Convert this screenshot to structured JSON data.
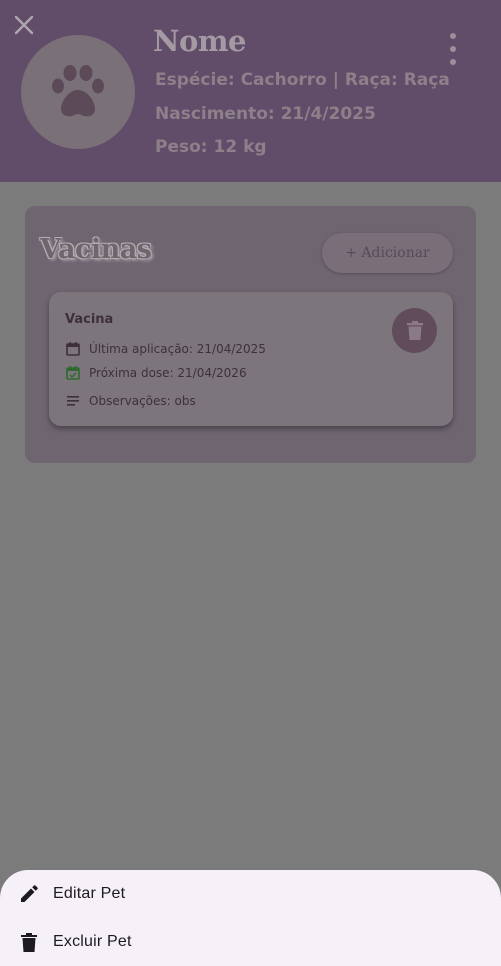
{
  "pet": {
    "name": "Nome",
    "species_line": "Espécie: Cachorro | Raça: Raça",
    "birth_line": "Nascimento: 21/4/2025",
    "weight_line": "Peso: 12 kg"
  },
  "vaccines": {
    "title": "Vacinas",
    "add_label": "+ Adicionar",
    "items": [
      {
        "name": "Vacina",
        "last_application": "Última aplicação: 21/04/2025",
        "next_dose": "Próxima dose: 21/04/2026",
        "notes": "Observações: obs"
      }
    ]
  },
  "menu": {
    "items": [
      {
        "label": "Editar Pet",
        "icon": "edit-icon"
      },
      {
        "label": "Excluir Pet",
        "icon": "trash-icon"
      }
    ]
  },
  "colors": {
    "header_bg": "#614c6a",
    "scrim": "#7b7b7b",
    "sheet_bg": "#f6f0f8",
    "next_dose_icon": "#2e7d32"
  }
}
